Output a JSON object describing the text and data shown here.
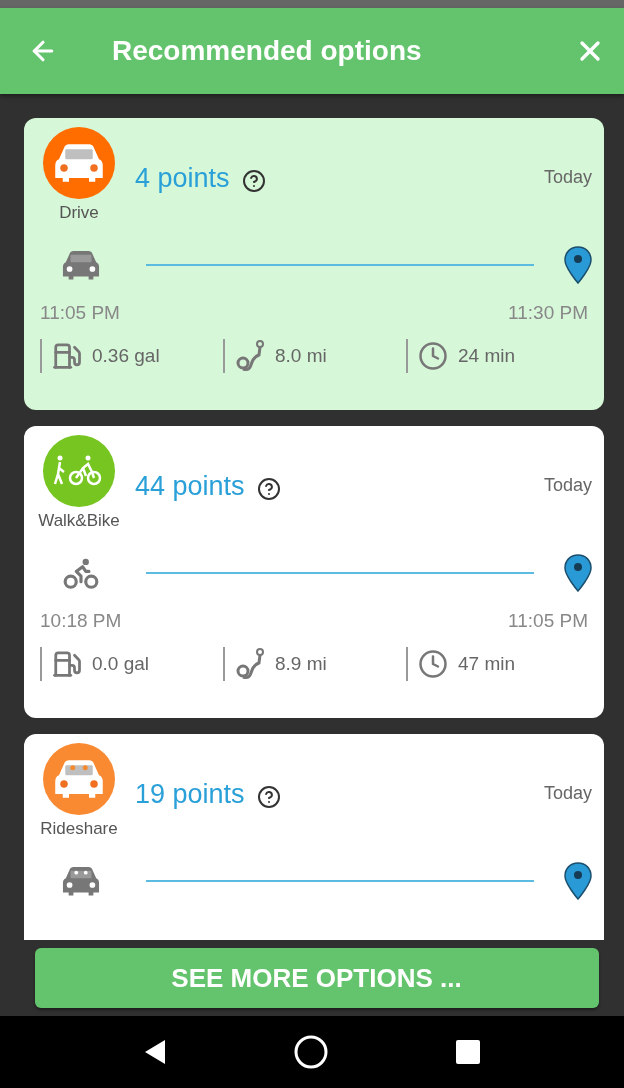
{
  "header": {
    "title": "Recommended options"
  },
  "options": [
    {
      "kind": "drive",
      "mode": "Drive",
      "color": "#ff6d00",
      "points": "4 points",
      "day": "Today",
      "selected": true,
      "depart": "11:05 PM",
      "arrive": "11:30 PM",
      "fuel": "0.36 gal",
      "distance": "8.0 mi",
      "duration": "24 min"
    },
    {
      "kind": "walkbike",
      "mode": "Walk&Bike",
      "color": "#76c520",
      "points": "44 points",
      "day": "Today",
      "selected": false,
      "depart": "10:18 PM",
      "arrive": "11:05 PM",
      "fuel": "0.0 gal",
      "distance": "8.9 mi",
      "duration": "47 min"
    },
    {
      "kind": "rideshare",
      "mode": "Rideshare",
      "color": "#f98a32",
      "points": "19 points",
      "day": "Today",
      "selected": false
    }
  ],
  "more_button": "SEE MORE OPTIONS ..."
}
